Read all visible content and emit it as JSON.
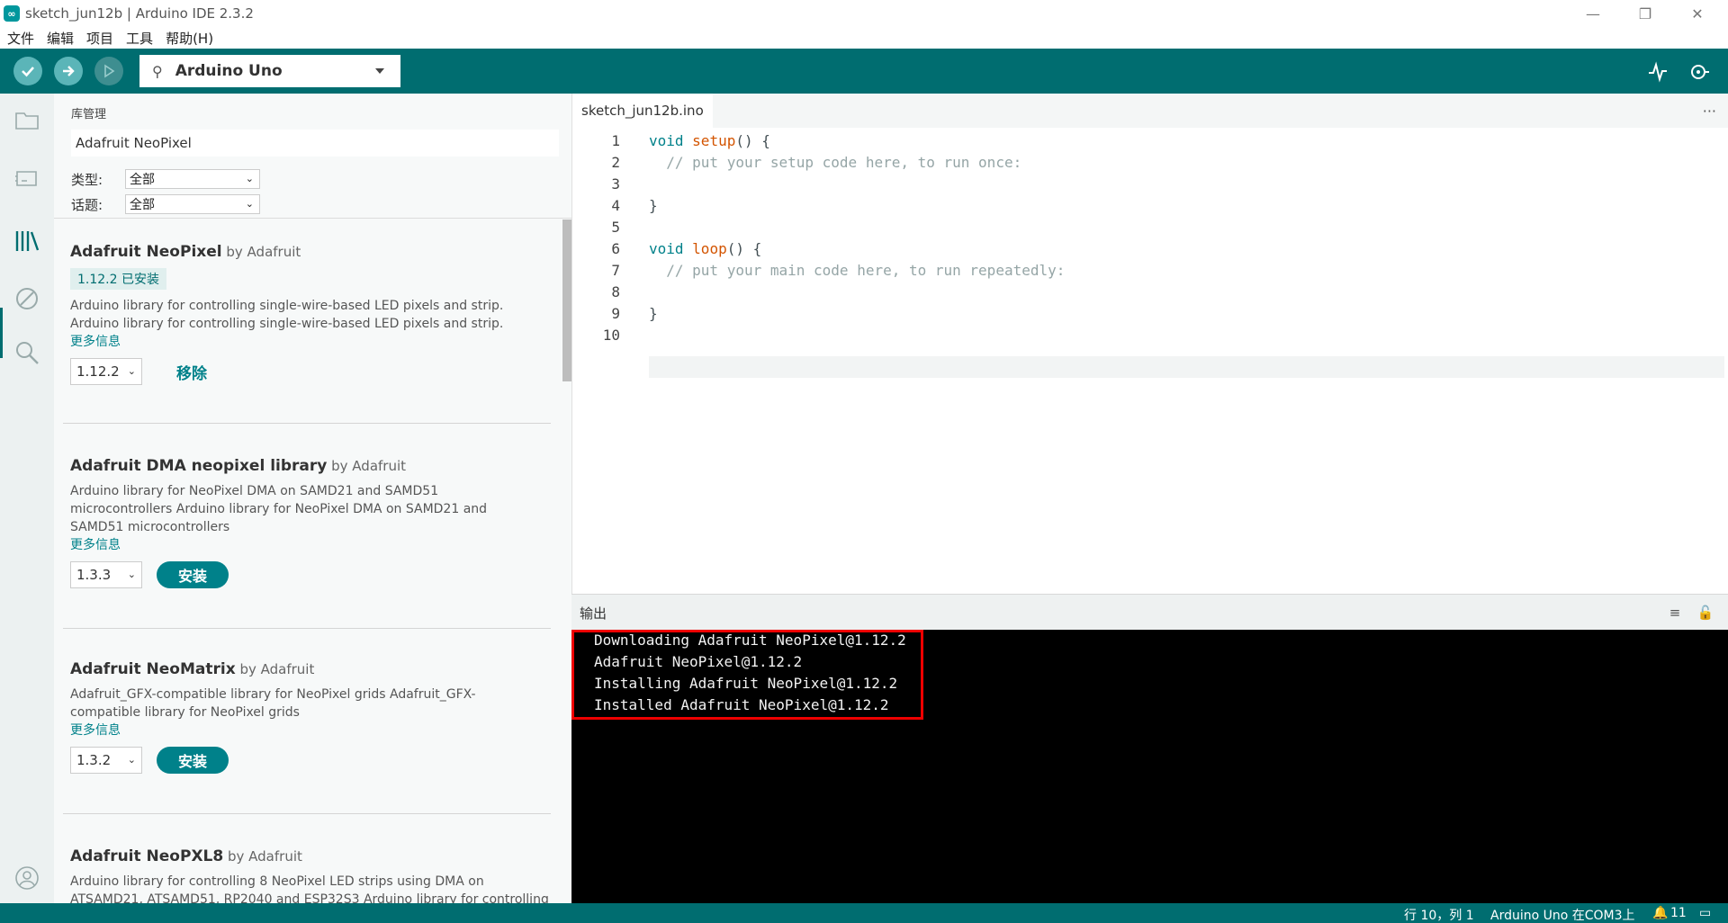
{
  "window": {
    "title": "sketch_jun12b | Arduino IDE 2.3.2",
    "controls": [
      "minimize",
      "restore",
      "close"
    ]
  },
  "menu": [
    "文件",
    "编辑",
    "项目",
    "工具",
    "帮助(H)"
  ],
  "toolbar": {
    "board": "Arduino Uno",
    "buttons": [
      "verify-icon",
      "upload-icon",
      "debug-icon",
      "serial-plotter-icon",
      "serial-monitor-icon"
    ]
  },
  "sidebar_icons": [
    "folder-icon",
    "board-icon",
    "library-icon",
    "debug-stop-icon",
    "search-icon",
    "account-icon"
  ],
  "library_manager": {
    "title": "库管理",
    "search_value": "Adafruit NeoPixel",
    "filters": {
      "type_label": "类型:",
      "type_value": "全部",
      "topic_label": "话题:",
      "topic_value": "全部"
    },
    "items": [
      {
        "name": "Adafruit NeoPixel",
        "by": "by Adafruit",
        "installed_badge": "1.12.2 已安装",
        "desc1": "Arduino library for controlling single-wire-based LED pixels and strip.",
        "desc2": "Arduino library for controlling single-wire-based LED pixels and strip.",
        "more": "更多信息",
        "version": "1.12.2",
        "action": "移除"
      },
      {
        "name": "Adafruit DMA neopixel library",
        "by": "by Adafruit",
        "desc1": "Arduino library for NeoPixel DMA on SAMD21 and SAMD51",
        "desc2": "microcontrollers Arduino library for NeoPixel DMA on SAMD21 and",
        "desc3": "SAMD51 microcontrollers",
        "more": "更多信息",
        "version": "1.3.3",
        "action": "安装"
      },
      {
        "name": "Adafruit NeoMatrix",
        "by": "by Adafruit",
        "desc1": "Adafruit_GFX-compatible library for NeoPixel grids Adafruit_GFX-",
        "desc2": "compatible library for NeoPixel grids",
        "more": "更多信息",
        "version": "1.3.2",
        "action": "安装"
      },
      {
        "name": "Adafruit NeoPXL8",
        "by": "by Adafruit",
        "desc1": "Arduino library for controlling 8 NeoPixel LED strips using DMA on",
        "desc2": "ATSAMD21, ATSAMD51, RP2040 and ESP32S3 Arduino library for controlling"
      }
    ]
  },
  "editor": {
    "tab": "sketch_jun12b.ino",
    "more": "···",
    "lines": [
      {
        "n": "1",
        "kw": "void ",
        "fn": "setup",
        "rest": "() {"
      },
      {
        "n": "2",
        "cm": "  // put your setup code here, to run once:"
      },
      {
        "n": "3"
      },
      {
        "n": "4",
        "rest": "}"
      },
      {
        "n": "5"
      },
      {
        "n": "6",
        "kw": "void ",
        "fn": "loop",
        "rest": "() {"
      },
      {
        "n": "7",
        "cm": "  // put your main code here, to run repeatedly:"
      },
      {
        "n": "8"
      },
      {
        "n": "9",
        "rest": "}"
      },
      {
        "n": "10"
      }
    ]
  },
  "output": {
    "label": "输出",
    "lines": [
      "Downloading Adafruit NeoPixel@1.12.2",
      "Adafruit NeoPixel@1.12.2",
      "Installing Adafruit NeoPixel@1.12.2",
      "Installed Adafruit NeoPixel@1.12.2"
    ]
  },
  "status": {
    "position": "行 10，列 1",
    "board_port": "Arduino Uno 在COM3上",
    "notifications": "11"
  },
  "colors": {
    "toolbar": "#006d70",
    "accent": "#00818a",
    "highlight_box": "#ee0000"
  }
}
